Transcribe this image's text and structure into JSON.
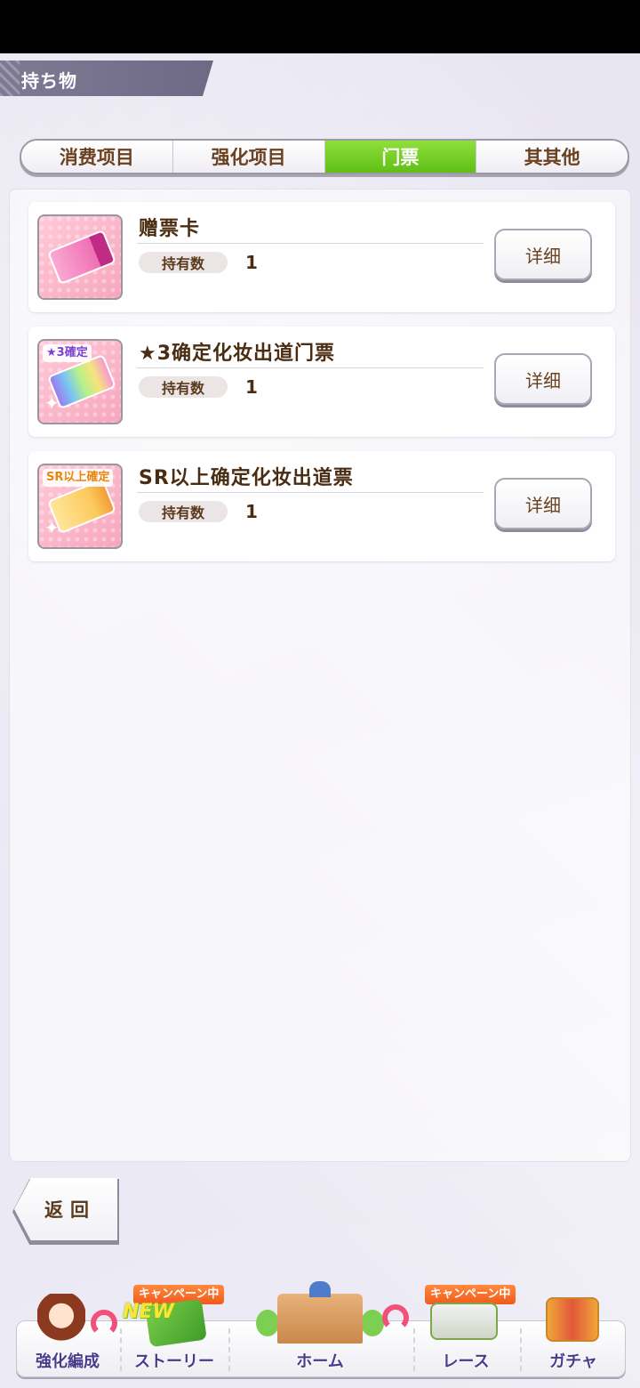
{
  "header": {
    "title": "持ち物"
  },
  "tabs": [
    {
      "label": "消费项目",
      "active": false
    },
    {
      "label": "强化项目",
      "active": false
    },
    {
      "label": "门票",
      "active": true
    },
    {
      "label": "其其他",
      "active": false
    }
  ],
  "items": [
    {
      "name": "赠票卡",
      "owned_label": "持有数",
      "count": "1",
      "detail_label": "详细",
      "icon": "ticket-card-icon"
    },
    {
      "name": "★3确定化妆出道门票",
      "owned_label": "持有数",
      "count": "1",
      "detail_label": "详细",
      "icon": "star3-ticket-icon",
      "badge": "★3確定"
    },
    {
      "name": "SR以上确定化妆出道票",
      "owned_label": "持有数",
      "count": "1",
      "detail_label": "详细",
      "icon": "sr-ticket-icon",
      "badge": "SR以上確定"
    }
  ],
  "back_button": {
    "label": "返回"
  },
  "nav": {
    "items": [
      {
        "label": "強化編成",
        "icon": "character-icon"
      },
      {
        "label": "ストーリー",
        "icon": "story-book-icon",
        "badge": "キャンペーン中",
        "new": "NEW"
      },
      {
        "label": "ホーム",
        "icon": "school-building-icon"
      },
      {
        "label": "レース",
        "icon": "race-gate-icon",
        "badge": "キャンペーン中"
      },
      {
        "label": "ガチャ",
        "icon": "gacha-door-icon"
      }
    ]
  },
  "colors": {
    "active_tab": "#6cc41a",
    "text_brown": "#5a3a1c",
    "header_bg": "#77728c",
    "campaign_badge": "#f05a1e"
  }
}
